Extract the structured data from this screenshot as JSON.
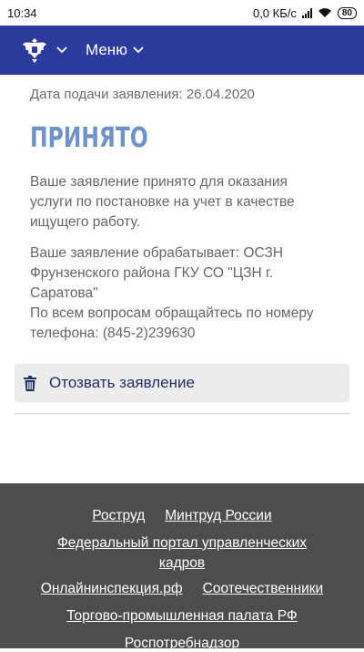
{
  "statusbar": {
    "time": "10:34",
    "net_speed": "0,0 КБ/с",
    "battery": "80"
  },
  "navbar": {
    "menu_label": "Меню"
  },
  "application": {
    "date_line": "Дата подачи заявления: 26.04.2020",
    "status": "ПРИНЯТО",
    "message": "Ваше заявление принято для оказания услуги по постановке на учет в качестве ищущего работу.",
    "processor_line": "Ваше заявление обрабатывает: ОСЗН Фрунзенского района ГКУ СО \"ЦЗН г. Саратова\"",
    "contact_line": "По всем вопросам обращайтесь по номеру телефона: (845-2)239630",
    "withdraw_label": "Отозвать заявление"
  },
  "footer": {
    "links": [
      "Роструд",
      "Минтруд России",
      "Федеральный портал управленческих кадров",
      "Онлайнинспекция.рф",
      "Соотечественники",
      "Торгово-промышленная палата РФ",
      "Роспотребнадзор"
    ]
  },
  "colors": {
    "navbar": "#2b3b9c",
    "status": "#6e93c9",
    "footer": "#4d4d4d",
    "withdraw_bg": "#ececec"
  },
  "icons": [
    "coat-of-arms-icon",
    "chevron-down-icon",
    "trash-icon",
    "signal-icon",
    "wifi-icon",
    "battery-icon"
  ]
}
